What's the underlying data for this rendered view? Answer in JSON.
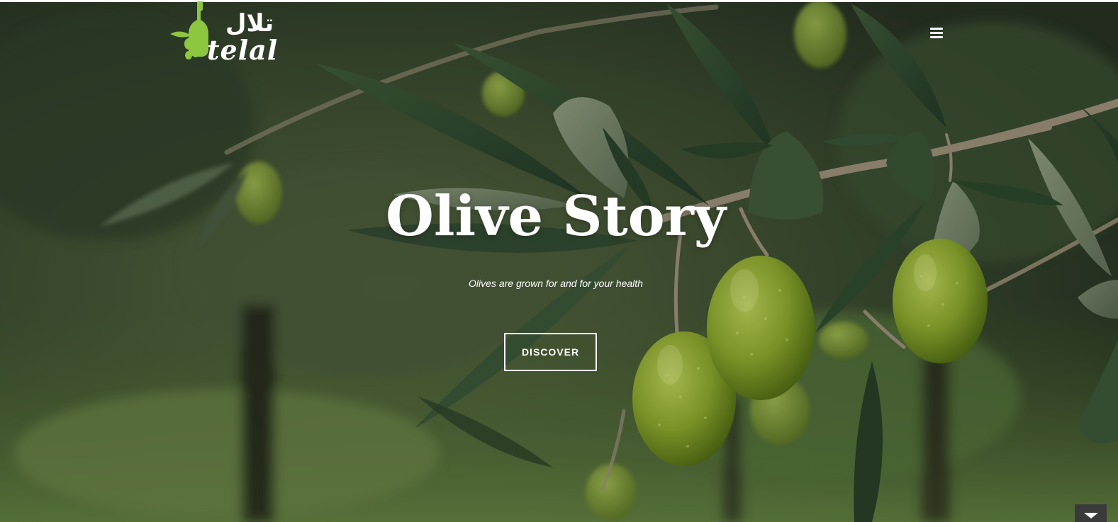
{
  "brand": {
    "arabic_name": "تلال",
    "latin_name": "telal"
  },
  "hero": {
    "title": "Olive Story",
    "subtitle": "Olives are grown for and for your health",
    "cta_label": "DISCOVER"
  },
  "icons": {
    "menu": "hamburger-menu-icon",
    "scroll": "chevron-down-icon",
    "logo_mark": "olive-bottle-icon"
  },
  "colors": {
    "logo_green": "#8dc63f",
    "text": "#ffffff",
    "scroll_button": "#3a3a3a"
  }
}
